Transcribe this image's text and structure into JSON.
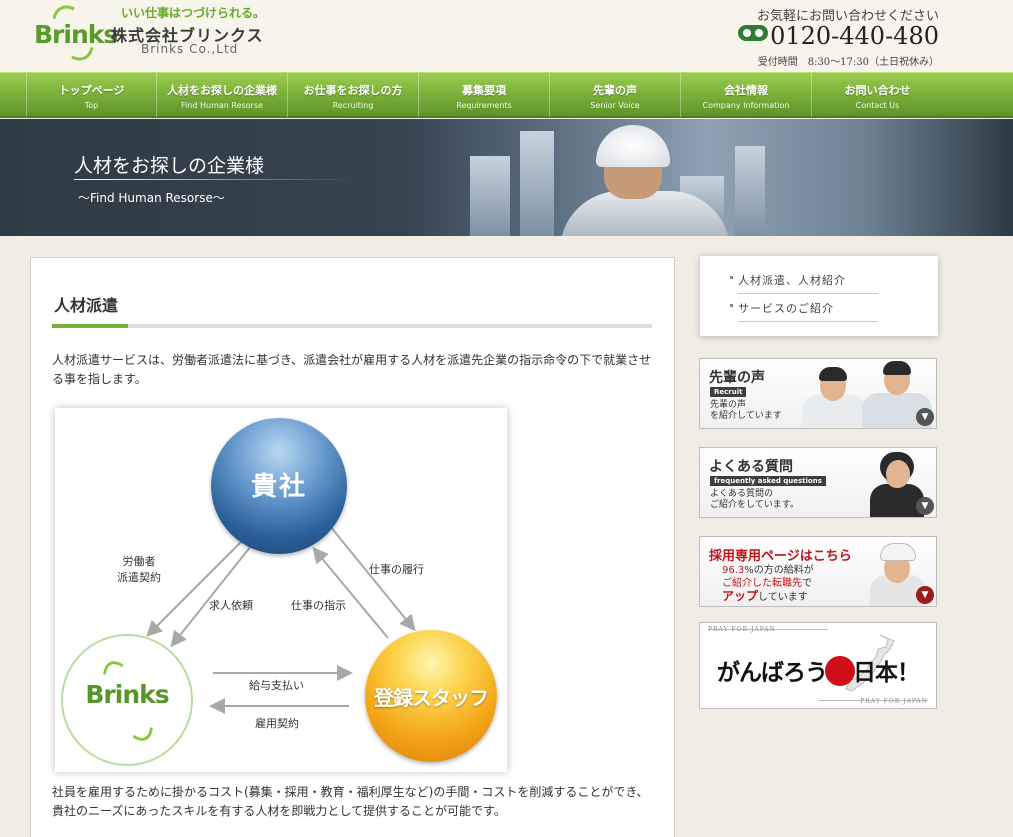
{
  "header": {
    "logo_mark": "Brinks",
    "tagline": "いい仕事はつづけられる。",
    "company": "株式会社ブリンクス",
    "company_en": "Brinks Co.,Ltd",
    "contact_label": "お気軽にお問い合わせください",
    "phone": "0120-440-480",
    "hours": "受付時間　8:30〜17:30（土日祝休み）"
  },
  "nav": [
    {
      "ja": "トップページ",
      "en": "Top"
    },
    {
      "ja": "人材をお探しの企業様",
      "en": "Find Human Resorse"
    },
    {
      "ja": "お仕事をお探しの方",
      "en": "Recruiting"
    },
    {
      "ja": "募集要項",
      "en": "Requirements"
    },
    {
      "ja": "先輩の声",
      "en": "Senior Voice"
    },
    {
      "ja": "会社情報",
      "en": "Company Information"
    },
    {
      "ja": "お問い合わせ",
      "en": "Contact Us"
    }
  ],
  "hero": {
    "title": "人材をお探しの企業様",
    "subtitle": "〜Find Human Resorse〜"
  },
  "main": {
    "section_title": "人材派遣",
    "intro": "人材派遣サービスは、労働者派遣法に基づき、派遣会社が雇用する人材を派遣先企業の指示命令の下で就業させる事を指します。",
    "bottom": "社員を雇用するために掛かるコスト(募集・採用・教育・福利厚生など)の手間・コストを削減することができ、貴社のニーズにあったスキルを有する人材を即戦力として提供することが可能です。"
  },
  "diagram": {
    "node_client": "貴社",
    "node_staff": "登録スタッフ",
    "node_brinks": "Brinks",
    "label_contract_1": "労働者",
    "label_contract_2": "派遣契約",
    "label_request": "求人依頼",
    "label_instruction": "仕事の指示",
    "label_performance": "仕事の履行",
    "label_salary": "給与支払い",
    "label_employment": "雇用契約"
  },
  "sidebar": {
    "menu": [
      "人材派遣、人材紹介",
      "サービスのご紹介"
    ],
    "banner_voice": {
      "title": "先輩の声",
      "tag": "Recruit",
      "desc_1": "先輩の声",
      "desc_2": "を紹介しています"
    },
    "banner_faq": {
      "title": "よくある質問",
      "tag": "frequently asked questions",
      "desc_1": "よくある質問の",
      "desc_2": "ご紹介をしています。"
    },
    "banner_recruit": {
      "title": "採用専用ページはこちら",
      "pct": "96.3",
      "desc_1": "%の方の給料が",
      "desc_2a": "ご紹介した転職先",
      "desc_2b": "で",
      "desc_3a": "アップ",
      "desc_3b": "しています"
    },
    "pray": {
      "top": "PRAY FOR JAPAN",
      "bottom": "PRAY FOR JAPAN",
      "text_a": "がんばろう",
      "text_b": "日本！"
    }
  },
  "colors": {
    "nav_green": "#7db33b",
    "accent_green": "#7ab03a",
    "client_blue": "#2b5f98",
    "staff_orange": "#f3a316",
    "red": "#c0141b"
  }
}
